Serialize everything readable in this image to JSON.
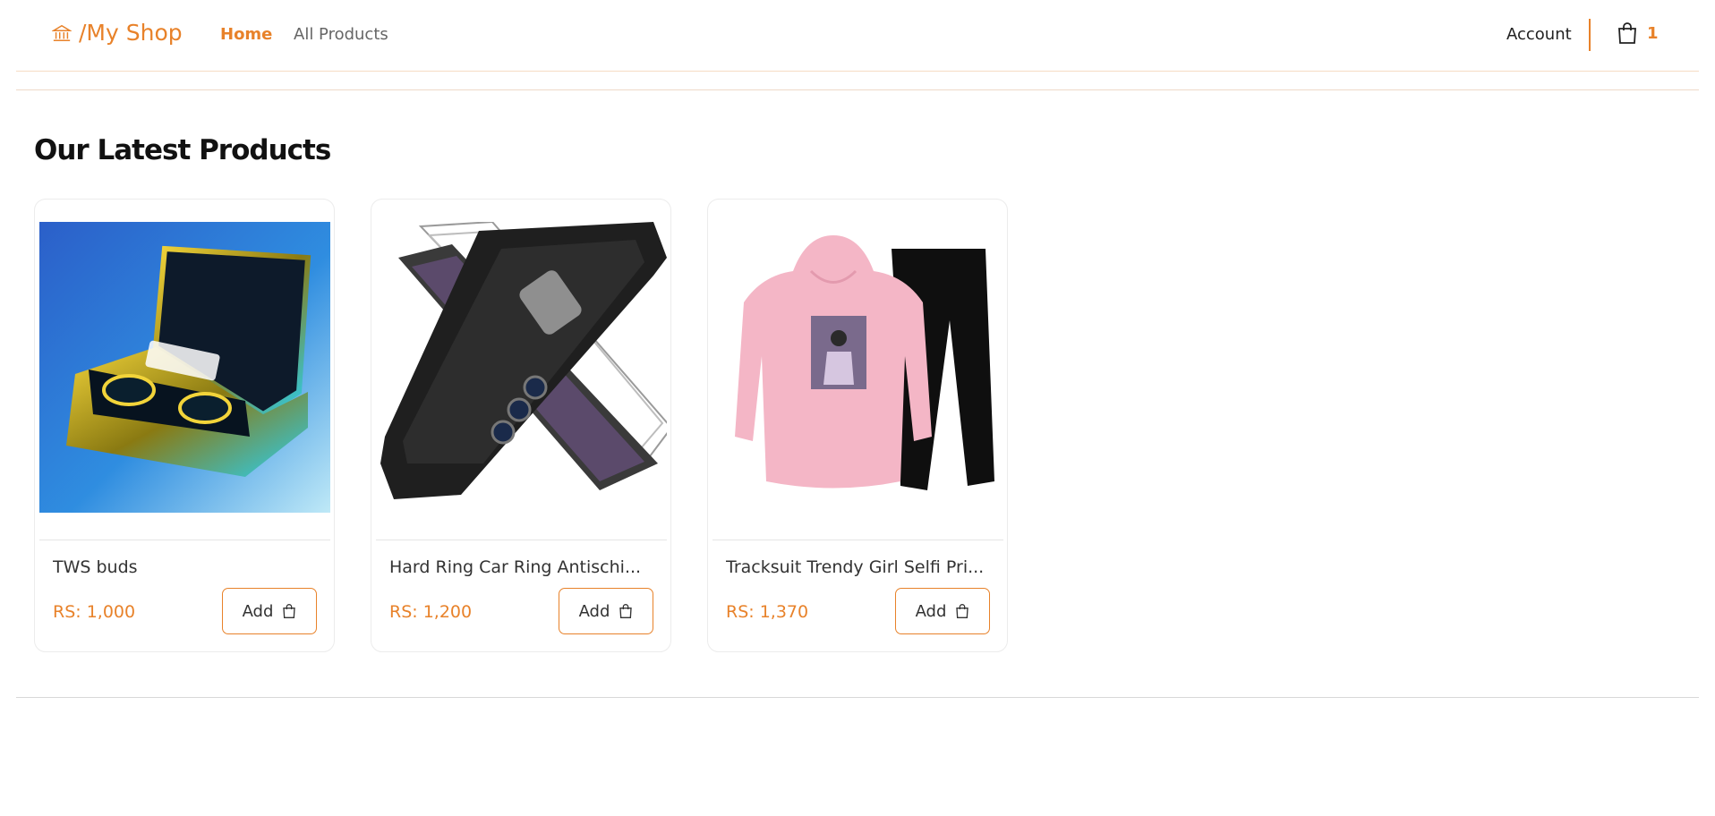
{
  "header": {
    "brand": "/My Shop",
    "nav": {
      "home": "Home",
      "all_products": "All Products"
    },
    "account": "Account",
    "cart_count": "1"
  },
  "section": {
    "title": "Our Latest Products"
  },
  "products": [
    {
      "name": "TWS buds",
      "price": "RS: 1,000",
      "add_label": "Add",
      "image": "earbuds-case-image"
    },
    {
      "name": "Hard Ring Car Ring Antischi...",
      "price": "RS: 1,200",
      "add_label": "Add",
      "image": "phone-case-image"
    },
    {
      "name": "Tracksuit Trendy Girl Selfi Pri...",
      "price": "RS: 1,370",
      "add_label": "Add",
      "image": "pink-hoodie-tracksuit-image"
    }
  ],
  "colors": {
    "accent": "#e8822a",
    "text": "#222222",
    "muted": "#666666"
  }
}
